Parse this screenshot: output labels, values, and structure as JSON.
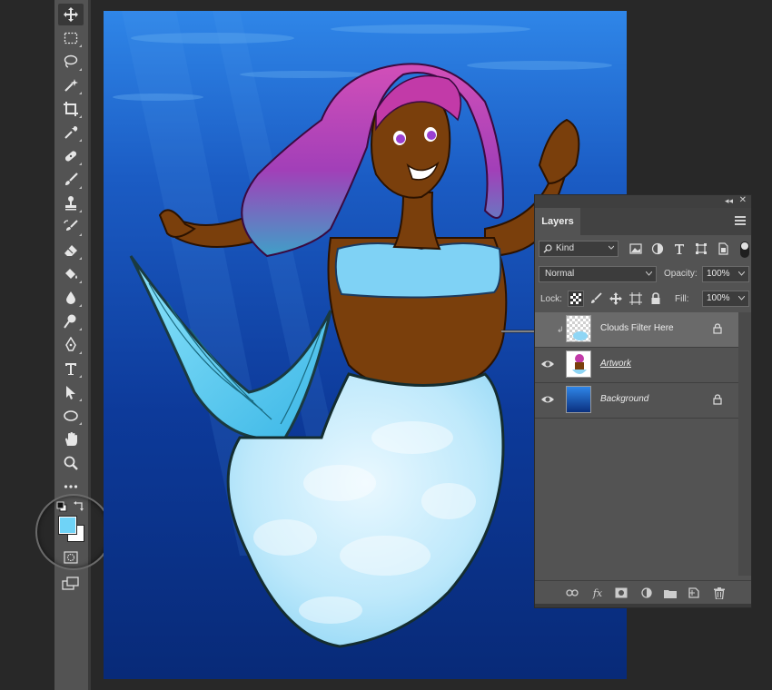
{
  "toolbar": {
    "tools": [
      "move-tool",
      "marquee-tool",
      "lasso-tool",
      "magic-wand-tool",
      "crop-tool",
      "eyedropper-tool",
      "healing-brush-tool",
      "brush-tool",
      "clone-stamp-tool",
      "history-brush-tool",
      "eraser-tool",
      "paint-bucket-tool",
      "blur-tool",
      "dodge-tool",
      "pen-tool",
      "type-tool",
      "path-selection-tool",
      "ellipse-tool",
      "hand-tool",
      "zoom-tool",
      "more-tools"
    ],
    "foreground_color": "#6fd3f7",
    "background_color": "#ffffff"
  },
  "layers_panel": {
    "tab_label": "Layers",
    "filter_kind_label": "Kind",
    "blend_mode": "Normal",
    "opacity_label": "Opacity:",
    "opacity_value": "100%",
    "lock_label": "Lock:",
    "fill_label": "Fill:",
    "fill_value": "100%",
    "layers": [
      {
        "name": "Clouds Filter Here",
        "visible": false,
        "locked": true,
        "selected": true
      },
      {
        "name": "Artwork",
        "visible": true,
        "locked": false,
        "selected": false
      },
      {
        "name": "Background",
        "visible": true,
        "locked": true,
        "selected": false
      }
    ]
  },
  "colors": {
    "canvas_deep_blue": "#0b2f86",
    "canvas_light_blue": "#2a7ee0",
    "hair_pink": "#c23aa8",
    "tail_light": "#bfe9fb",
    "skin": "#7a3f0c",
    "top": "#7fd2f5"
  }
}
